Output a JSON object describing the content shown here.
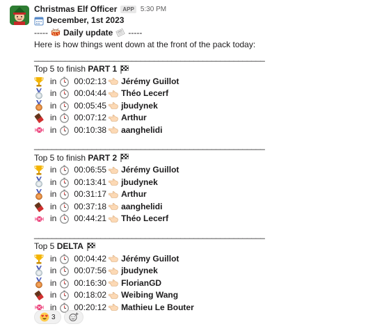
{
  "app": {
    "name": "Christmas Elf Officer",
    "badge": "APP",
    "time": "5:30 PM"
  },
  "header": {
    "date": "December, 1st 2023",
    "update_left": "-----",
    "update_label": "Daily update",
    "update_right": "-----",
    "intro": "Here is how things went down at the front of the pack today:"
  },
  "separator": "____________________________________________________",
  "sections": [
    {
      "prefix": "Top 5 to finish",
      "title": "PART 1",
      "rows": [
        {
          "medal": "trophy",
          "time": "00:02:13",
          "name": "Jérémy Guillot"
        },
        {
          "medal": "silver",
          "time": "00:04:44",
          "name": "Théo Lecerf"
        },
        {
          "medal": "bronze",
          "time": "00:05:45",
          "name": "jbudynek"
        },
        {
          "medal": "chocolate",
          "time": "00:07:12",
          "name": "Arthur"
        },
        {
          "medal": "candy",
          "time": "00:10:38",
          "name": "aanghelidi"
        }
      ]
    },
    {
      "prefix": "Top 5 to finish",
      "title": "PART 2",
      "rows": [
        {
          "medal": "trophy",
          "time": "00:06:55",
          "name": "Jérémy Guillot"
        },
        {
          "medal": "silver",
          "time": "00:13:41",
          "name": "jbudynek"
        },
        {
          "medal": "bronze",
          "time": "00:31:17",
          "name": "Arthur"
        },
        {
          "medal": "chocolate",
          "time": "00:37:18",
          "name": "aanghelidi"
        },
        {
          "medal": "candy",
          "time": "00:44:21",
          "name": "Théo Lecerf"
        }
      ]
    },
    {
      "prefix": "Top 5",
      "title": "DELTA",
      "rows": [
        {
          "medal": "trophy",
          "time": "00:04:42",
          "name": "Jérémy Guillot"
        },
        {
          "medal": "silver",
          "time": "00:07:56",
          "name": "jbudynek"
        },
        {
          "medal": "bronze",
          "time": "00:16:30",
          "name": "FlorianGD"
        },
        {
          "medal": "chocolate",
          "time": "00:18:02",
          "name": "Weibing Wang"
        },
        {
          "medal": "candy",
          "time": "00:20:12",
          "name": "Mathieu Le Bouter"
        }
      ]
    }
  ],
  "row_word": "in",
  "reactions": [
    {
      "emoji": "heart-eyes-icon",
      "count": "3"
    }
  ],
  "colors": {
    "bg": "#ffffff",
    "text": "#1d1c1d",
    "muted": "#616061",
    "reaction_bg": "#f1f1f1"
  }
}
